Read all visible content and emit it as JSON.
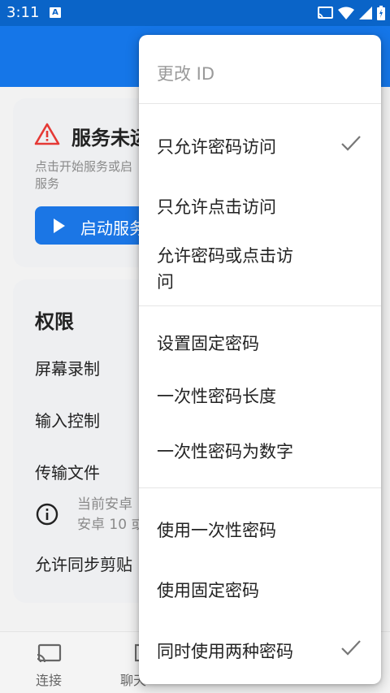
{
  "status_bar": {
    "time": "3:11",
    "notif_letter": "A"
  },
  "service_card": {
    "title": "服务未运",
    "desc_line1": "点击开始服务或启",
    "desc_line2": "服务",
    "start_button": "启动服务"
  },
  "permissions": {
    "title": "权限",
    "items": [
      "屏幕录制",
      "输入控制",
      "传输文件",
      "允许同步剪贴"
    ],
    "info_line1": "当前安卓",
    "info_line2": "安卓 10 或"
  },
  "bottom_nav": {
    "connect": "连接",
    "chat": "聊天"
  },
  "menu": {
    "change_id": "更改 ID",
    "password_only": "只允许密码访问",
    "click_only": "只允许点击访问",
    "password_or_click_line1": "允许密码或点击访",
    "password_or_click_line2": "问",
    "set_fixed_password": "设置固定密码",
    "otp_length": "一次性密码长度",
    "otp_numeric": "一次性密码为数字",
    "use_otp": "使用一次性密码",
    "use_fixed": "使用固定密码",
    "use_both": "同时使用两种密码"
  },
  "colors": {
    "primary": "#1576e8",
    "status_bar": "#0a64c8",
    "warning": "#e53935"
  }
}
